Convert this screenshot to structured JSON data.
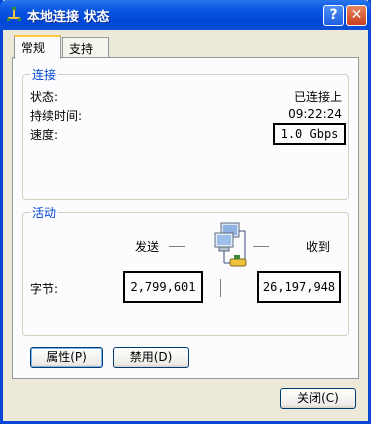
{
  "window": {
    "title": "本地连接 状态",
    "help_label": "?",
    "close_label": "✕"
  },
  "tabs": [
    {
      "label": "常规",
      "active": true
    },
    {
      "label": "支持",
      "active": false
    }
  ],
  "connection": {
    "group_title": "连接",
    "status_label": "状态:",
    "status_value": "已连接上",
    "duration_label": "持续时间:",
    "duration_value": "09:22:24",
    "speed_label": "速度:",
    "speed_value": "1.0 Gbps"
  },
  "activity": {
    "group_title": "活动",
    "sent_label": "发送",
    "received_label": "收到",
    "bytes_label": "字节:",
    "bytes_sent": "2,799,601",
    "bytes_received": "26,197,948"
  },
  "buttons": {
    "properties": "属性(P)",
    "disable": "禁用(D)",
    "close": "关闭(C)"
  },
  "icons": {
    "title_icon": "network-connection-icon",
    "activity_icon": "network-computers-icon"
  },
  "colors": {
    "title_bar": "#0a59e5",
    "group_title": "#0046d5",
    "close_button": "#c8401b"
  }
}
